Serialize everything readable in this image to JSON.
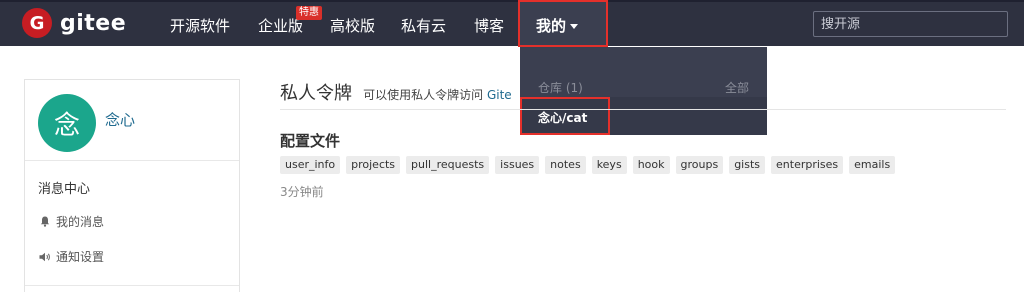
{
  "navbar": {
    "logo_letter": "G",
    "logo_text": "gitee",
    "items": [
      "开源软件",
      "企业版",
      "高校版",
      "私有云",
      "博客"
    ],
    "promo_badge": "特惠",
    "mine_label": "我的",
    "search_placeholder": "搜开源"
  },
  "dropdown": {
    "section_label": "仓库 (1)",
    "all_link": "全部",
    "repo_item": "念心/cat"
  },
  "sidebar": {
    "avatar_char": "念",
    "user_name": "念心",
    "section_title": "消息中心",
    "links": [
      "我的消息",
      "通知设置"
    ]
  },
  "main": {
    "title": "私人令牌",
    "subtitle": "可以使用私人令牌访问",
    "subtitle_link": "Gite",
    "config_label": "配置文件",
    "scopes": [
      "user_info",
      "projects",
      "pull_requests",
      "issues",
      "notes",
      "keys",
      "hook",
      "groups",
      "gists",
      "enterprises",
      "emails"
    ],
    "created_time": "3分钟前"
  },
  "colors": {
    "navbar_bg": "#2e3140",
    "brand_red": "#c71d23",
    "highlight_red": "#e4302b",
    "avatar_green": "#1ba68c",
    "link_blue": "#1f6a8f"
  }
}
